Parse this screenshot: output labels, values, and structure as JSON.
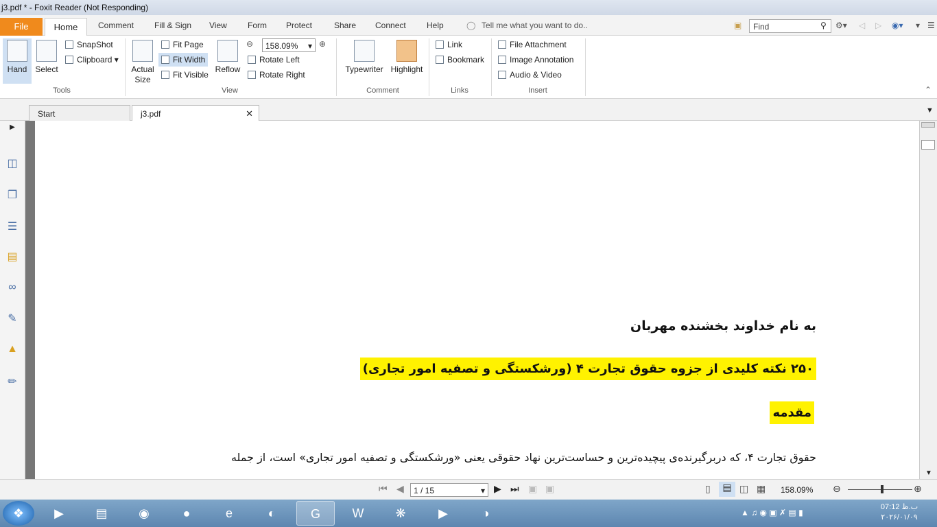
{
  "window": {
    "title": "j3.pdf * - Foxit Reader (Not Responding)"
  },
  "menu": {
    "file": "File",
    "tabs": [
      "Home",
      "Comment",
      "Fill & Sign",
      "View",
      "Form",
      "Protect",
      "Share",
      "Connect",
      "Help"
    ],
    "tell_me": "Tell me what you want to do..",
    "find_placeholder": "Find"
  },
  "ribbon": {
    "tools": {
      "hand": "Hand",
      "select": "Select",
      "snapshot": "SnapShot",
      "clipboard": "Clipboard",
      "label": "Tools"
    },
    "view": {
      "actual_size": "Actual Size",
      "fit_page": "Fit Page",
      "fit_width": "Fit Width",
      "fit_visible": "Fit Visible",
      "reflow": "Reflow",
      "zoom": "158.09%",
      "rotate_left": "Rotate Left",
      "rotate_right": "Rotate Right",
      "label": "View"
    },
    "comment": {
      "typewriter": "Typewriter",
      "highlight": "Highlight",
      "label": "Comment"
    },
    "links": {
      "link": "Link",
      "bookmark": "Bookmark",
      "label": "Links"
    },
    "insert": {
      "file_attachment": "File Attachment",
      "image_annotation": "Image Annotation",
      "audio_video": "Audio & Video",
      "label": "Insert"
    }
  },
  "tabs": {
    "start": "Start",
    "doc": "j3.pdf"
  },
  "document": {
    "line1": "به نام خداوند بخشنده مهربان",
    "line2": "۲۵۰ نکته کلیدی از جزوه حقوق تجارت ۴ (ورشکستگی و تصفیه امور تجاری)",
    "line3": "مقدمه",
    "line4": "حقوق تجارت ۴، که دربرگیرنده‌ی پیچیده‌ترین و حساست‌ترین نهاد حقوقی یعنی «ورشکستگی و تصفیه امور تجاری» است، از جمله"
  },
  "status": {
    "page": "1 / 15",
    "zoom": "158.09%"
  },
  "taskbar": {
    "time": "07:12 ب.ظ",
    "date": "۲۰۲۶/۰۱/۰۹"
  },
  "colors": {
    "file_tab": "#f08a1c",
    "highlight": "#fff200"
  }
}
